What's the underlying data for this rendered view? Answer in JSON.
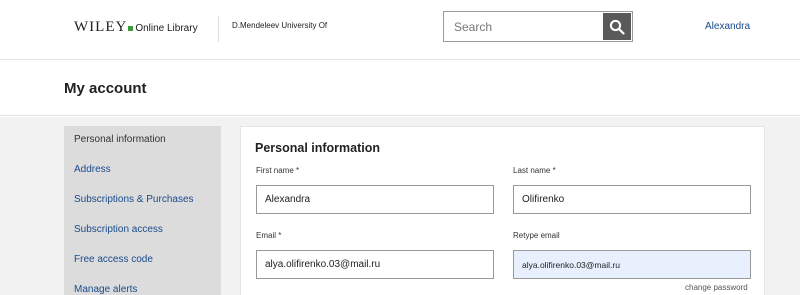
{
  "header": {
    "logo_brand": "WILEY",
    "logo_product": "Online Library",
    "institution": "D.Mendeleev University Of",
    "search_placeholder": "Search",
    "user_name": "Alexandra"
  },
  "page": {
    "title": "My account"
  },
  "sidebar": {
    "items": [
      {
        "label": "Personal information",
        "active": true
      },
      {
        "label": "Address"
      },
      {
        "label": "Subscriptions & Purchases"
      },
      {
        "label": "Subscription access"
      },
      {
        "label": "Free access code"
      },
      {
        "label": "Manage alerts"
      }
    ]
  },
  "form": {
    "title": "Personal information",
    "first_name": {
      "label": "First name *",
      "value": "Alexandra"
    },
    "last_name": {
      "label": "Last name *",
      "value": "Olifirenko"
    },
    "email": {
      "label": "Email *",
      "value": "alya.olifirenko.03@mail.ru"
    },
    "retype_email": {
      "label": "Retype email",
      "value": "alya.olifirenko.03@mail.ru"
    },
    "change_password": "change password"
  },
  "colors": {
    "link": "#1a4b8c",
    "logo_accent": "#3a9a3a",
    "search_button": "#5a5a5a",
    "sidebar_bg": "#dcdcdc",
    "autofill_bg": "#e8f0fe"
  },
  "icons": {
    "search": "magnifier-icon"
  }
}
